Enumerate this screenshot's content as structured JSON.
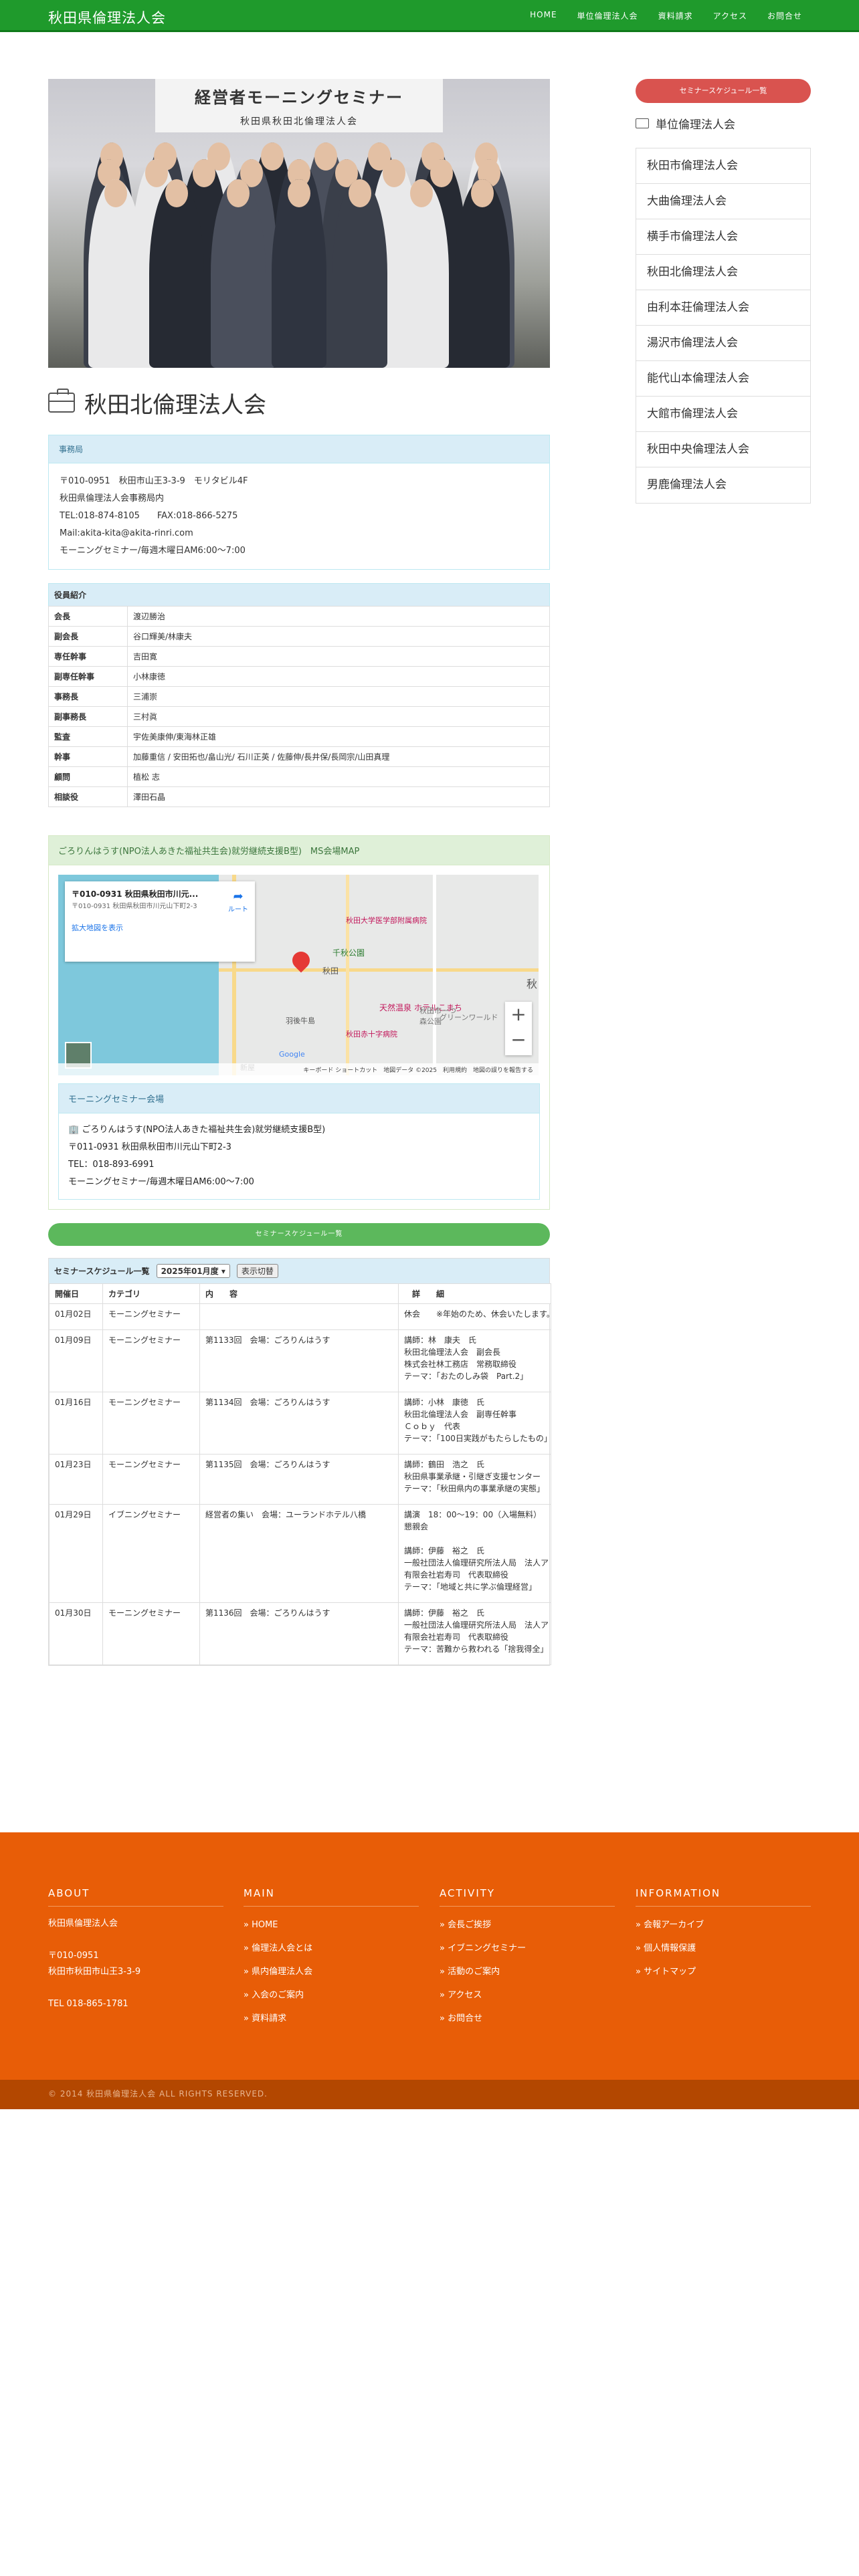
{
  "header": {
    "site_title": "秋田県倫理法人会",
    "nav": [
      "HOME",
      "単位倫理法人会",
      "資料請求",
      "アクセス",
      "お問合せ"
    ]
  },
  "photo": {
    "banner_line1": "経営者モーニングセミナー",
    "banner_line2": "秋田県秋田北倫理法人会"
  },
  "page_title": "秋田北倫理法人会",
  "office": {
    "heading": "事務局",
    "lines": [
      "〒010-0951　秋田市山王3-3-9　モリタビル4F",
      "秋田県倫理法人会事務局内",
      "TEL:018-874-8105　　FAX:018-866-5275",
      "Mail:akita-kita@akita-rinri.com",
      "モーニングセミナー/毎週木曜日AM6:00〜7:00"
    ]
  },
  "officers": {
    "caption": "役員紹介",
    "rows": [
      {
        "role": "会長",
        "name": "渡辺勝治"
      },
      {
        "role": "副会長",
        "name": "谷口輝美/林康夫"
      },
      {
        "role": "専任幹事",
        "name": "吉田寛"
      },
      {
        "role": "副専任幹事",
        "name": "小林康徳"
      },
      {
        "role": "事務長",
        "name": "三浦崇"
      },
      {
        "role": "副事務長",
        "name": "三村眞"
      },
      {
        "role": "監査",
        "name": "宇佐美康伸/東海林正雄"
      },
      {
        "role": "幹事",
        "name": "加藤重信 / 安田拓也/畠山光/ 石川正英 / 佐藤伸/長井保/長岡宗/山田真理"
      },
      {
        "role": "顧問",
        "name": "植松 志"
      },
      {
        "role": "相談役",
        "name": "澤田石晶"
      }
    ]
  },
  "venue": {
    "heading": "ごろりんはうす(NPO法人あきた福祉共生会)就労継続支援B型)　MS会場MAP",
    "map": {
      "card_title": "〒010-0931 秋田県秋田市川元...",
      "card_address": "〒010-0931 秋田県秋田市川元山下町2-3",
      "card_link": "拡大地図を表示",
      "route": "ルート",
      "labels": [
        "千秋公園",
        "秋田",
        "秋田大学医学部附属病院",
        "秋田市一つ森公園",
        "天然温泉 ホテルこまち",
        "秋田赤十字病院",
        "グリーンワールド",
        "羽後牛島",
        "新屋",
        "秋"
      ],
      "footer": "キーボード ショートカット　地図データ ©2025　利用規約　地図の誤りを報告する",
      "google": "Google",
      "zoom_in": "+",
      "zoom_out": "−"
    },
    "meeting_heading": "モーニングセミナー会場",
    "meeting_lines": [
      "ごろりんはうす(NPO法人あきた福祉共生会)就労継続支援B型)",
      "〒011-0931 秋田県秋田市川元山下町2-3",
      "TEL：018-893-6991",
      "モーニングセミナー/毎週木曜日AM6:00〜7:00"
    ]
  },
  "green_button": "セミナースケジュール一覧",
  "schedule": {
    "label": "セミナースケジュール一覧",
    "selected_month": "2025年01月度",
    "switch_button": "表示切替",
    "headers": [
      "開催日",
      "カテゴリ",
      "内　　容",
      "詳　　細"
    ],
    "rows": [
      {
        "date": "01月02日",
        "category": "モーニングセミナー",
        "content": "",
        "detail": [
          "休会　　※年始のため、休会いたします。"
        ]
      },
      {
        "date": "01月09日",
        "category": "モーニングセミナー",
        "content": "第1133回　会場：ごろりんはうす",
        "detail": [
          "講師：林　康夫　氏",
          "秋田北倫理法人会　副会長",
          "株式会社林工務店　常務取締役",
          "テーマ：「おたのしみ袋　Part.2」"
        ]
      },
      {
        "date": "01月16日",
        "category": "モーニングセミナー",
        "content": "第1134回　会場：ごろりんはうす",
        "detail": [
          "講師：小林　康徳　氏",
          "秋田北倫理法人会　副専任幹事",
          "Ｃｏｂｙ　代表",
          "テーマ：「100日実践がもたらしたもの」"
        ]
      },
      {
        "date": "01月23日",
        "category": "モーニングセミナー",
        "content": "第1135回　会場：ごろりんはうす",
        "detail": [
          "講師：鶴田　浩之　氏",
          "秋田県事業承継・引継ぎ支援センター",
          "テーマ：「秋田県内の事業承継の実態」"
        ]
      },
      {
        "date": "01月29日",
        "category": "イブニングセミナー",
        "content": "経営者の集い　会場：ユーランドホテル八橋",
        "detail": [
          "講演　18：00〜19：00（入場無料）",
          "懇親会",
          "",
          "講師：伊藤　裕之　氏",
          "一般社団法人倫理研究所法人局　法人アドバイザー",
          "有限会社岩寿司　代表取締役",
          "テーマ：「地域と共に学ぶ倫理経営」"
        ]
      },
      {
        "date": "01月30日",
        "category": "モーニングセミナー",
        "content": "第1136回　会場：ごろりんはうす",
        "detail": [
          "講師：伊藤　裕之　氏",
          "一般社団法人倫理研究所法人局　法人アドバイザー",
          "有限会社岩寿司　代表取締役",
          "テーマ：苦難から救われる「捨我得全」"
        ]
      }
    ]
  },
  "sidebar": {
    "schedule_button": "セミナースケジュール一覧",
    "heading": "単位倫理法人会",
    "items": [
      "秋田市倫理法人会",
      "大曲倫理法人会",
      "横手市倫理法人会",
      "秋田北倫理法人会",
      "由利本荘倫理法人会",
      "湯沢市倫理法人会",
      "能代山本倫理法人会",
      "大館市倫理法人会",
      "秋田中央倫理法人会",
      "男鹿倫理法人会"
    ]
  },
  "footer": {
    "about": {
      "title": "ABOUT",
      "lines": [
        "秋田県倫理法人会",
        "",
        "〒010-0951",
        "秋田市秋田市山王3-3-9",
        "",
        "TEL 018-865-1781"
      ]
    },
    "main": {
      "title": "MAIN",
      "links": [
        "» HOME",
        "» 倫理法人会とは",
        "» 県内倫理法人会",
        "» 入会のご案内",
        "» 資料請求"
      ]
    },
    "activity": {
      "title": "ACTIVITY",
      "links": [
        "» 会長ご挨拶",
        "» イブニングセミナー",
        "» 活動のご案内",
        "» アクセス",
        "» お問合せ"
      ]
    },
    "information": {
      "title": "INFORMATION",
      "links": [
        "» 会報アーカイブ",
        "» 個人情報保護",
        "» サイトマップ"
      ]
    },
    "copyright": "© 2014 秋田県倫理法人会  ALL RIGHTS RESERVED."
  },
  "colors": {
    "header_green": "#1f9a2c",
    "footer_orange": "#e85d07",
    "accent_red": "#d9534f",
    "button_green": "#5cb85c"
  }
}
